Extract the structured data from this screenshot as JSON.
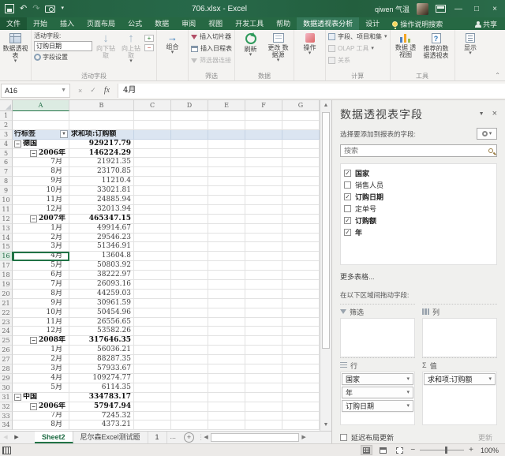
{
  "titlebar": {
    "title": "706.xlsx - Excel",
    "user": "qiwen 气温"
  },
  "ribbon_tabs": {
    "items": [
      "文件",
      "开始",
      "插入",
      "页面布局",
      "公式",
      "数据",
      "审阅",
      "视图",
      "开发工具",
      "帮助",
      "数据透视表分析",
      "设计"
    ],
    "active": "数据透视表分析",
    "tell_me": "操作说明搜索",
    "share": "共享"
  },
  "ribbon": {
    "pivottable_btn": "数据透视表",
    "active_field": {
      "label": "活动字段:",
      "value": "订购日期",
      "field_settings": "字段设置",
      "drill_down": "向下钻取",
      "drill_up": "向上钻 取",
      "group_label": "活动字段"
    },
    "group_btn": "组合",
    "filter_group": {
      "slicer": "插入切片器",
      "timeline": "插入日程表",
      "connections": "筛选器连接",
      "label": "筛选"
    },
    "data_group": {
      "refresh": "刷新",
      "change_source": "更改 数据源",
      "label": "数据"
    },
    "actions_btn": "操作",
    "calc_group": {
      "fields_items": "字段、项目和集",
      "olap": "OLAP 工具",
      "relations": "关系",
      "label": "计算"
    },
    "tools_group": {
      "pivotchart": "数据 透视图",
      "recommended": "推荐的数 据透视表",
      "label": "工具"
    },
    "show_btn": "显示"
  },
  "formula_bar": {
    "name_box": "A16",
    "content": "4月"
  },
  "grid": {
    "columns": [
      "A",
      "B",
      "C",
      "D",
      "E",
      "F",
      "G"
    ],
    "header": {
      "row_label": "行标签",
      "value_label": "求和项:订购额"
    },
    "rows": [
      {
        "n": 1
      },
      {
        "n": 2
      },
      {
        "n": 3,
        "type": "header"
      },
      {
        "n": 4,
        "a": "德国",
        "b": "929217.79",
        "lvl": 0,
        "exp": true,
        "bold": true
      },
      {
        "n": 5,
        "a": "2006年",
        "b": "146224.29",
        "lvl": 1,
        "exp": true,
        "bold": true
      },
      {
        "n": 6,
        "a": "7月",
        "b": "21921.35",
        "lvl": 2
      },
      {
        "n": 7,
        "a": "8月",
        "b": "23170.85",
        "lvl": 2
      },
      {
        "n": 8,
        "a": "9月",
        "b": "11210.4",
        "lvl": 2
      },
      {
        "n": 9,
        "a": "10月",
        "b": "33021.81",
        "lvl": 2
      },
      {
        "n": 10,
        "a": "11月",
        "b": "24885.94",
        "lvl": 2
      },
      {
        "n": 11,
        "a": "12月",
        "b": "32013.94",
        "lvl": 2
      },
      {
        "n": 12,
        "a": "2007年",
        "b": "465347.15",
        "lvl": 1,
        "exp": true,
        "bold": true
      },
      {
        "n": 13,
        "a": "1月",
        "b": "49914.67",
        "lvl": 2
      },
      {
        "n": 14,
        "a": "2月",
        "b": "29546.23",
        "lvl": 2
      },
      {
        "n": 15,
        "a": "3月",
        "b": "51346.91",
        "lvl": 2
      },
      {
        "n": 16,
        "a": "4月",
        "b": "13604.8",
        "lvl": 2,
        "sel": true
      },
      {
        "n": 17,
        "a": "5月",
        "b": "50803.92",
        "lvl": 2
      },
      {
        "n": 18,
        "a": "6月",
        "b": "38222.97",
        "lvl": 2
      },
      {
        "n": 19,
        "a": "7月",
        "b": "26093.16",
        "lvl": 2
      },
      {
        "n": 20,
        "a": "8月",
        "b": "44259.03",
        "lvl": 2
      },
      {
        "n": 21,
        "a": "9月",
        "b": "30961.59",
        "lvl": 2
      },
      {
        "n": 22,
        "a": "10月",
        "b": "50454.96",
        "lvl": 2
      },
      {
        "n": 23,
        "a": "11月",
        "b": "26556.65",
        "lvl": 2
      },
      {
        "n": 24,
        "a": "12月",
        "b": "53582.26",
        "lvl": 2
      },
      {
        "n": 25,
        "a": "2008年",
        "b": "317646.35",
        "lvl": 1,
        "exp": true,
        "bold": true
      },
      {
        "n": 26,
        "a": "1月",
        "b": "56036.21",
        "lvl": 2
      },
      {
        "n": 27,
        "a": "2月",
        "b": "88287.35",
        "lvl": 2
      },
      {
        "n": 28,
        "a": "3月",
        "b": "57933.67",
        "lvl": 2
      },
      {
        "n": 29,
        "a": "4月",
        "b": "109274.77",
        "lvl": 2
      },
      {
        "n": 30,
        "a": "5月",
        "b": "6114.35",
        "lvl": 2
      },
      {
        "n": 31,
        "a": "中国",
        "b": "334783.17",
        "lvl": 0,
        "exp": true,
        "bold": true
      },
      {
        "n": 32,
        "a": "2006年",
        "b": "57947.94",
        "lvl": 1,
        "exp": true,
        "bold": true
      },
      {
        "n": 33,
        "a": "7月",
        "b": "7245.32",
        "lvl": 2
      },
      {
        "n": 34,
        "a": "8月",
        "b": "4373.21",
        "lvl": 2
      }
    ]
  },
  "panel": {
    "title": "数据透视表字段",
    "choose_label": "选择要添加到报表的字段:",
    "search_placeholder": "搜索",
    "fields": [
      {
        "name": "国家",
        "checked": true
      },
      {
        "name": "销售人员",
        "checked": false
      },
      {
        "name": "订购日期",
        "checked": true
      },
      {
        "name": "定单号",
        "checked": false
      },
      {
        "name": "订购额",
        "checked": true
      },
      {
        "name": "年",
        "checked": true
      }
    ],
    "more_tables": "更多表格...",
    "drag_hint": "在以下区域间拖动字段:",
    "areas": {
      "filters": {
        "label": "筛选",
        "items": []
      },
      "columns": {
        "label": "列",
        "items": []
      },
      "rows": {
        "label": "行",
        "items": [
          "国家",
          "年",
          "订购日期"
        ]
      },
      "values": {
        "label": "值",
        "items": [
          "求和项:订购额"
        ]
      }
    },
    "defer_label": "延迟布局更新",
    "update_btn": "更新"
  },
  "sheetbar": {
    "tabs": [
      "Sheet2",
      "尼尔森Excel测试题",
      "1"
    ],
    "active": "Sheet2",
    "ellipsis": "..."
  },
  "statusbar": {
    "zoom": "100%"
  },
  "glyphs": {
    "dropdown": "▾",
    "nb_dropdown": "▼",
    "close": "×",
    "check": "✓",
    "fx": "fx",
    "undo": "↶",
    "redo": "↷",
    "down_arrow": "↓",
    "up_arrow": "↑",
    "right_arrow": "→",
    "plus": "+",
    "minus": "−",
    "sigma": "Σ",
    "up_tri": "▲",
    "down_tri": "▼",
    "left_tri": "◀",
    "right_tri": "▶",
    "collapse": "⌃",
    "outline_minus": "−",
    "pane_options": "▼",
    "qmark": "?"
  }
}
